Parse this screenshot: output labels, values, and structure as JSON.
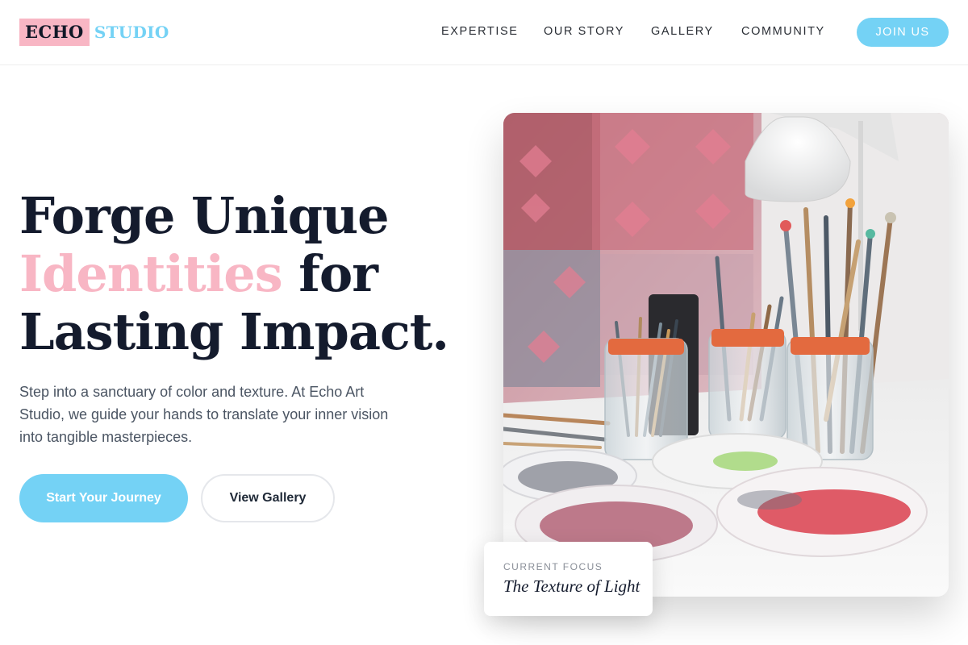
{
  "brand": {
    "logo_part1": "ECHO",
    "logo_part2": "STUDIO",
    "accent_color": "#74d2f5",
    "pink_color": "#f8b6c4"
  },
  "nav": {
    "items": [
      {
        "label": "EXPERTISE"
      },
      {
        "label": "OUR STORY"
      },
      {
        "label": "GALLERY"
      },
      {
        "label": "COMMUNITY"
      }
    ],
    "cta_label": "JOIN US"
  },
  "hero": {
    "headline_line1": "Forge Unique",
    "headline_highlight": "Identities",
    "headline_line2_rest": " for",
    "headline_line3": "Lasting Impact.",
    "lead": "Step into a sanctuary of color and texture. At Echo Art Studio, we guide your hands to translate your inner vision into tangible masterpieces.",
    "primary_button": "Start Your Journey",
    "secondary_button": "View Gallery"
  },
  "image": {
    "subject": "paintbrushes in glass jars with paint palettes"
  },
  "focus_card": {
    "label": "CURRENT FOCUS",
    "title": "The Texture of Light"
  }
}
